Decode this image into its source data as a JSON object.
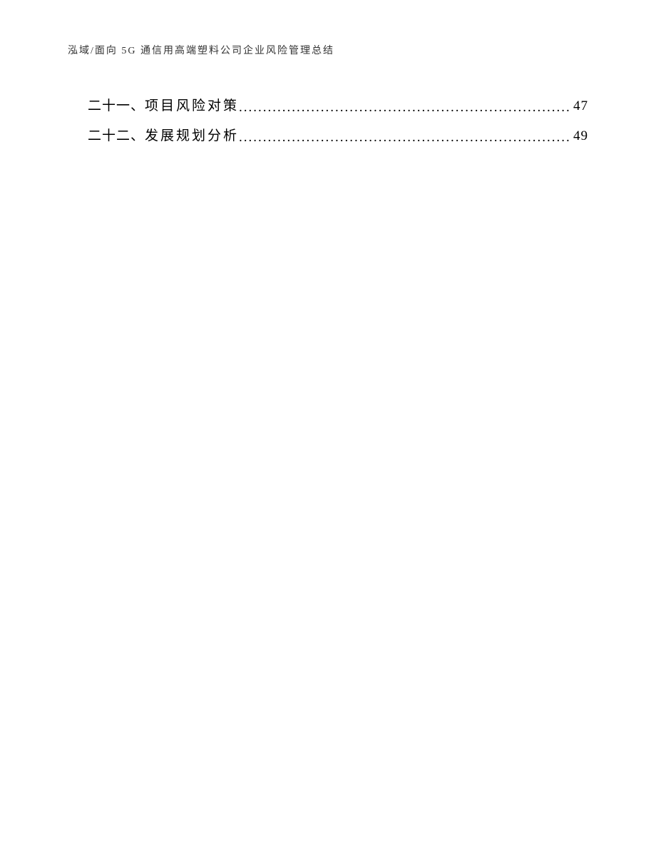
{
  "header": "泓域/面向 5G 通信用高端塑料公司企业风险管理总结",
  "toc": [
    {
      "number": "二十一、",
      "title": "项目风险对策",
      "page": "47"
    },
    {
      "number": "二十二、",
      "title": "发展规划分析",
      "page": "49"
    }
  ]
}
